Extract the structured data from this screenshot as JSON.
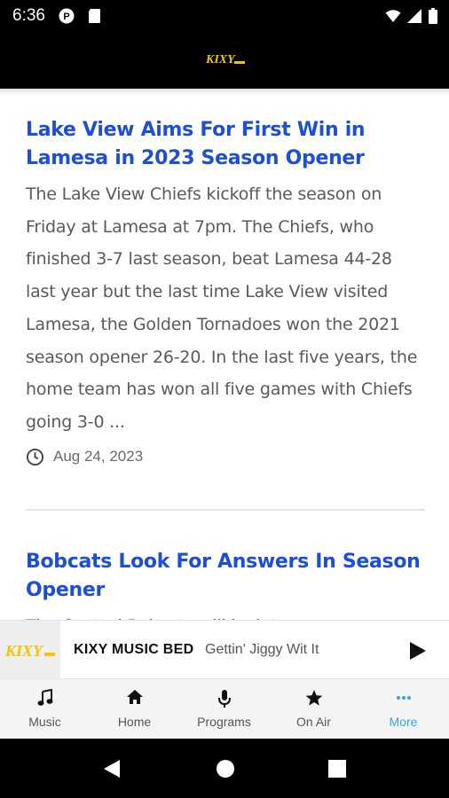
{
  "status_bar": {
    "time": "6:36"
  },
  "app_bar": {
    "logo": "KIXY logo",
    "logo_text": "KIXY"
  },
  "articles": [
    {
      "title": "Lake View Aims For First Win in Lamesa in 2023 Season Opener",
      "excerpt": "The Lake View Chiefs kickoff the season on Friday at Lamesa at 7pm. The Chiefs, who finished 3-7 last season, beat Lamesa 44-28 last year but the last time Lake View visited Lamesa, the Golden Tornadoes won the 2021 season opener 26-20. In the last five years, the home team has won all five games with Chiefs going 3-0 ...",
      "date": "Aug 24, 2023"
    },
    {
      "title": "Bobcats Look For Answers In Season Opener",
      "excerpt": "The Central Bobcats will look to answer"
    }
  ],
  "player": {
    "station": "KIXY MUSIC BED",
    "track": "Gettin' Jiggy Wit It"
  },
  "tabs": [
    {
      "label": "Music",
      "icon": "music-note-icon"
    },
    {
      "label": "Home",
      "icon": "home-icon"
    },
    {
      "label": "Programs",
      "icon": "microphone-icon"
    },
    {
      "label": "On Air",
      "icon": "star-icon"
    },
    {
      "label": "More",
      "icon": "more-dots-icon",
      "active": true
    }
  ],
  "colors": {
    "link": "#1d4ed8",
    "active_tab": "#2fa7e0",
    "logo_yellow": "#f5c400"
  }
}
